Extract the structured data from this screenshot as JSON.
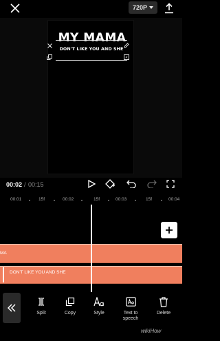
{
  "topbar": {
    "resolution": "720P"
  },
  "preview": {
    "title": "MY MAMA",
    "subtitle": "DON'T LIKE YOU AND SHE"
  },
  "playback": {
    "current_time": "00:02",
    "separator": "/",
    "total_time": "00:15"
  },
  "ruler": {
    "ticks": [
      "00:01",
      "15f",
      "00:02",
      "15f",
      "00:03",
      "15f",
      "00:04"
    ]
  },
  "tracks": {
    "clip1_label": "MA",
    "clip2_label": "DON'T LIKE YOU AND SHE"
  },
  "toolbar": {
    "items": [
      {
        "label": "Split",
        "icon": "split-icon"
      },
      {
        "label": "Copy",
        "icon": "copy-icon"
      },
      {
        "label": "Style",
        "icon": "style-icon"
      },
      {
        "label": "Text to speech",
        "icon": "text-to-speech-icon"
      },
      {
        "label": "Delete",
        "icon": "delete-icon"
      }
    ],
    "watermark": "wikiHow"
  },
  "colors": {
    "clip": "#f07f5e",
    "background": "#000000",
    "accent": "#ffffff"
  }
}
